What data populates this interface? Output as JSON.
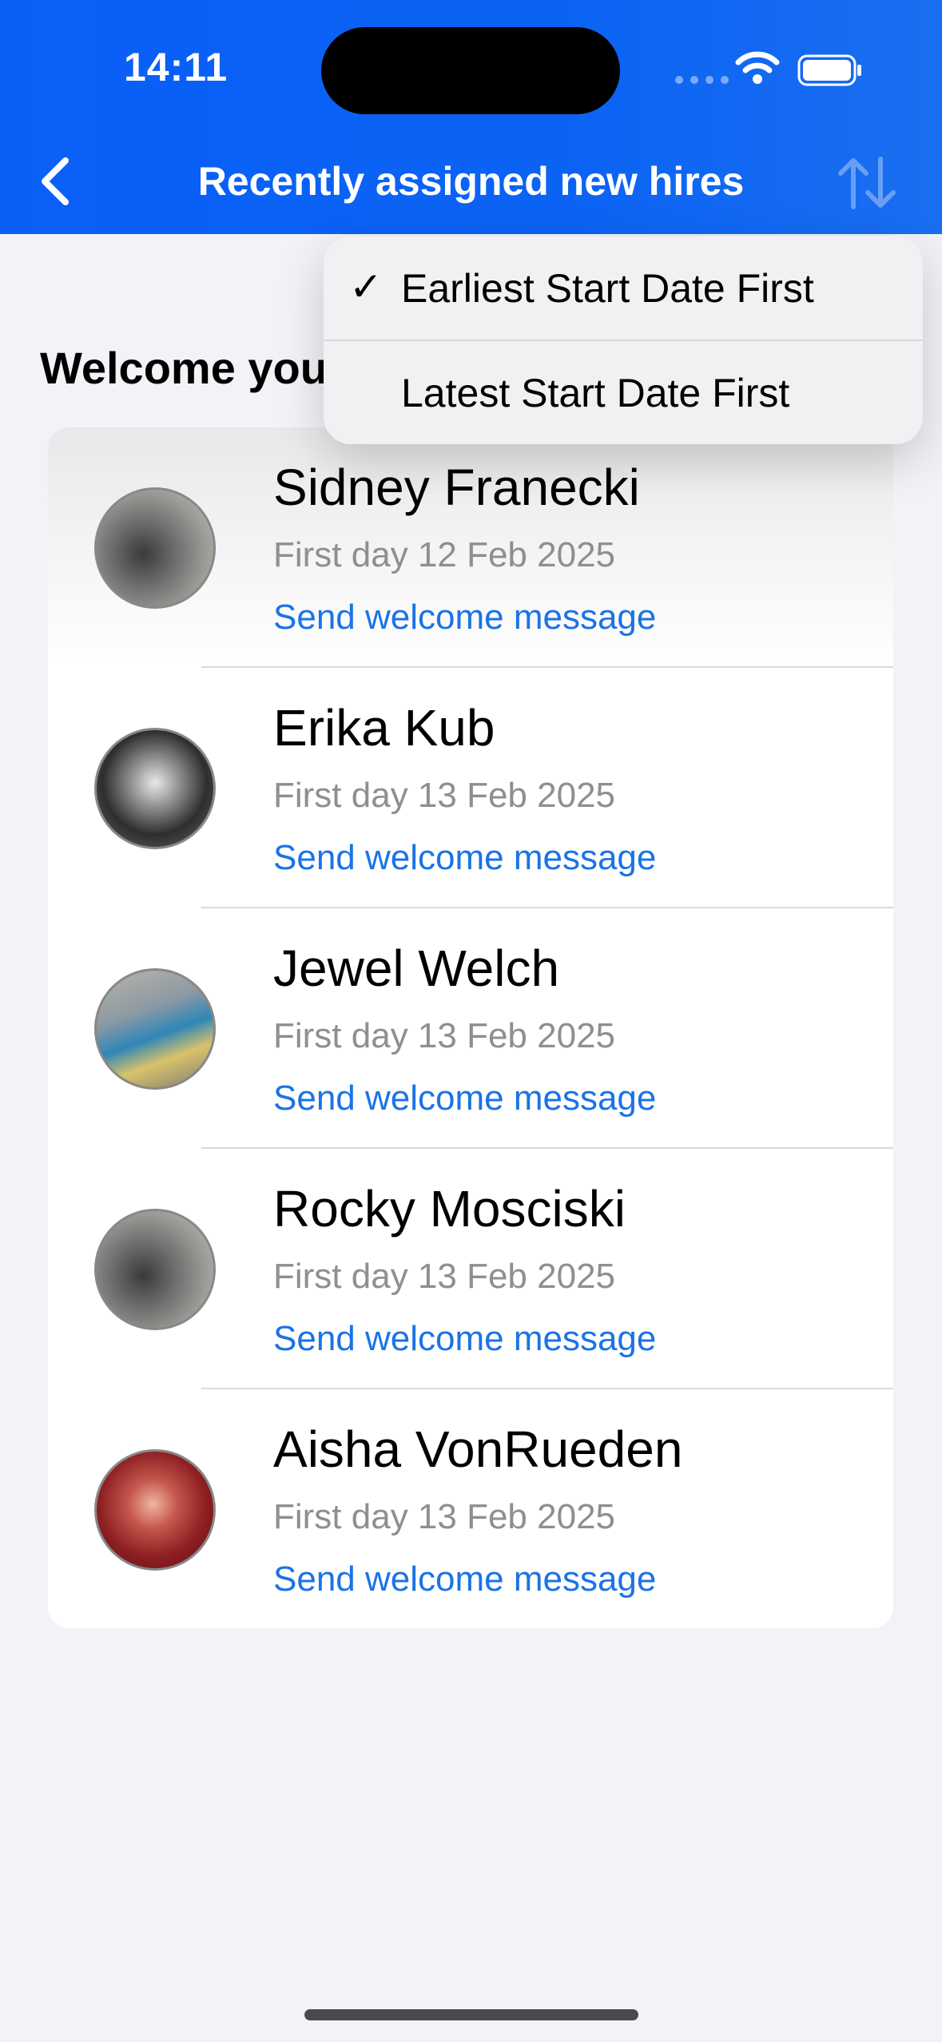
{
  "status_bar": {
    "time": "14:11"
  },
  "nav": {
    "title": "Recently assigned new hires"
  },
  "section": {
    "title": "Welcome you"
  },
  "hires": [
    {
      "name": "Sidney Franecki",
      "first_day": "First day 12 Feb 2025",
      "action": "Send welcome message"
    },
    {
      "name": "Erika Kub",
      "first_day": "First day 13 Feb 2025",
      "action": "Send welcome message"
    },
    {
      "name": "Jewel Welch",
      "first_day": "First day 13 Feb 2025",
      "action": "Send welcome message"
    },
    {
      "name": "Rocky Mosciski",
      "first_day": "First day 13 Feb 2025",
      "action": "Send welcome message"
    },
    {
      "name": "Aisha VonRueden",
      "first_day": "First day 13 Feb 2025",
      "action": "Send welcome message"
    }
  ],
  "sort_menu": {
    "options": [
      {
        "label": "Earliest Start Date First",
        "selected": true,
        "check": "✓"
      },
      {
        "label": "Latest Start Date First",
        "selected": false
      }
    ]
  },
  "colors": {
    "nav_blue": "#0a5ff7",
    "link_blue": "#1a73e8",
    "secondary_text": "#8e8e93",
    "background": "#f2f2f7"
  },
  "icons": [
    "back-chevron-icon",
    "sort-arrows-icon",
    "wifi-icon",
    "battery-icon",
    "checkmark-icon"
  ]
}
